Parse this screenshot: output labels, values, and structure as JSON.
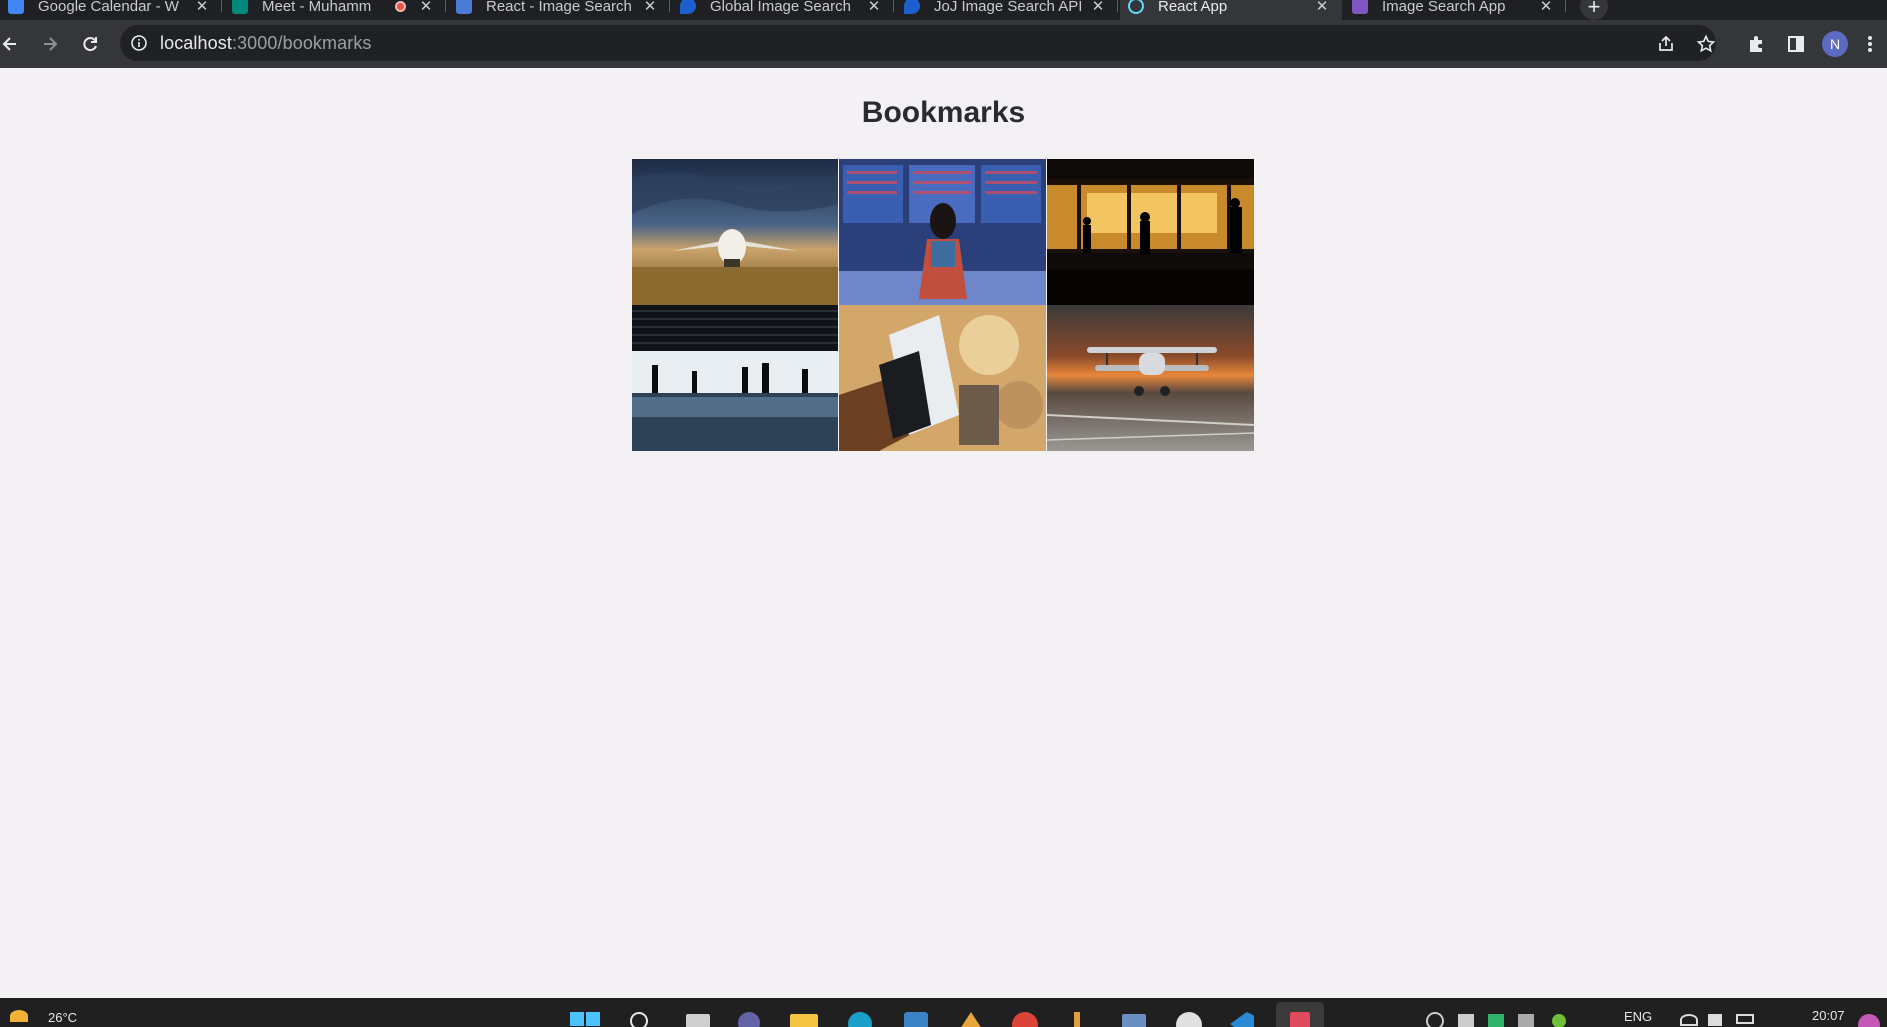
{
  "browser": {
    "tabs": [
      {
        "title": "Google Calendar - W",
        "favicon_color": "#4285f4",
        "recording": false
      },
      {
        "title": "Meet - Muhamm",
        "favicon_color": "#00897b",
        "recording": true
      },
      {
        "title": "React - Image Search",
        "favicon_color": "#4a7bd6",
        "recording": false
      },
      {
        "title": "Global Image Search",
        "favicon_color": "#1e5fcf",
        "recording": false
      },
      {
        "title": "JoJ Image Search API",
        "favicon_color": "#1e5fcf",
        "recording": false
      },
      {
        "title": "React App",
        "favicon_color": "#61dafb",
        "recording": false,
        "active": true
      },
      {
        "title": "Image Search App",
        "favicon_color": "#7e57c2",
        "recording": false
      }
    ],
    "new_tab_label": "+",
    "close_glyph": "✕",
    "url_host": "localhost",
    "url_path": ":3000/bookmarks",
    "avatar_letter": "N"
  },
  "page": {
    "title": "Bookmarks",
    "bookmarks": [
      {
        "alt": "Cargo plane on runway at dusk",
        "icon": "image-airplane-dusk"
      },
      {
        "alt": "Traveler at airport departures board",
        "icon": "image-departures-board"
      },
      {
        "alt": "Silhouettes at airport window sunset",
        "icon": "image-terminal-sunset"
      },
      {
        "alt": "Silhouettes in airport terminal hall",
        "icon": "image-terminal-hall"
      },
      {
        "alt": "Hand holding passport and boarding pass",
        "icon": "image-passport"
      },
      {
        "alt": "Biplane on tarmac at sunset",
        "icon": "image-biplane"
      }
    ]
  },
  "taskbar": {
    "weather": "26°C",
    "language": "ENG",
    "time": "20:07"
  }
}
